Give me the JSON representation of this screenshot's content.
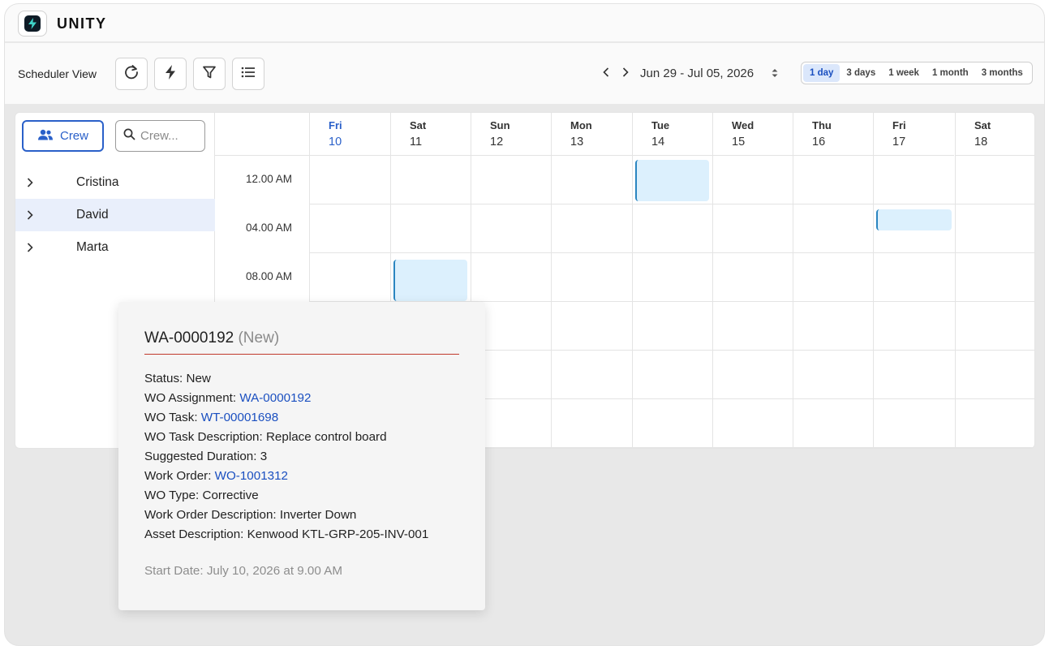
{
  "app": {
    "title": "UNITY",
    "logo_icon": "bolt-icon"
  },
  "toolbar": {
    "view_label": "Scheduler View",
    "buttons": [
      {
        "icon": "refresh-icon"
      },
      {
        "icon": "bolt-icon"
      },
      {
        "icon": "filter-icon"
      },
      {
        "icon": "list-icon"
      }
    ],
    "date_range": "Jun 29 - Jul 05, 2026",
    "ranges": [
      "1 day",
      "3 days",
      "1 week",
      "1 month",
      "3 months"
    ],
    "active_range": "1 day"
  },
  "crew_panel": {
    "crew_button_label": "Crew",
    "search_placeholder": "Crew...",
    "members": [
      {
        "name": "Cristina",
        "selected": false
      },
      {
        "name": "David",
        "selected": true
      },
      {
        "name": "Marta",
        "selected": false
      }
    ]
  },
  "calendar": {
    "days": [
      {
        "dow": "Fri",
        "num": "10",
        "today": true
      },
      {
        "dow": "Sat",
        "num": "11",
        "today": false
      },
      {
        "dow": "Sun",
        "num": "12",
        "today": false
      },
      {
        "dow": "Mon",
        "num": "13",
        "today": false
      },
      {
        "dow": "Tue",
        "num": "14",
        "today": false
      },
      {
        "dow": "Wed",
        "num": "15",
        "today": false
      },
      {
        "dow": "Thu",
        "num": "16",
        "today": false
      },
      {
        "dow": "Fri",
        "num": "17",
        "today": false
      },
      {
        "dow": "Sat",
        "num": "18",
        "today": false
      }
    ],
    "times": [
      "12.00 AM",
      "04.00 AM",
      "08.00 AM"
    ]
  },
  "tooltip": {
    "title": "WA-0000192",
    "state": "(New)",
    "status_label": "Status:",
    "status_value": "New",
    "assignment_label": "WO Assignment:",
    "assignment_value": "WA-0000192",
    "task_label": "WO Task:",
    "task_value": "WT-00001698",
    "task_desc_label": "WO Task Description:",
    "task_desc_value": "Replace control board",
    "duration_label": "Suggested Duration:",
    "duration_value": "3",
    "work_order_label": "Work Order:",
    "work_order_value": "WO-1001312",
    "type_label": "WO Type:",
    "type_value": "Corrective",
    "wo_desc_label": "Work Order Description:",
    "wo_desc_value": "Inverter Down",
    "asset_label": "Asset Description:",
    "asset_value": "Kenwood KTL-GRP-205-INV-001",
    "start_date": "Start Date: July 10, 2026 at 9.00 AM"
  },
  "colors": {
    "accent": "#2a60c9",
    "event_fill": "#dcf0fd",
    "event_border": "#2a85c0",
    "tooltip_rule": "#c0392b"
  }
}
